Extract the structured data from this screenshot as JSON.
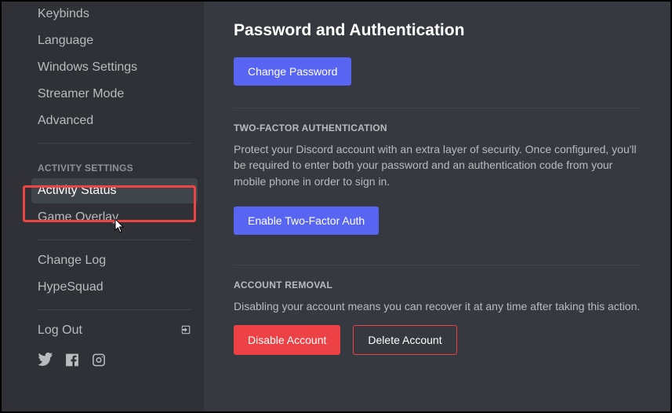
{
  "sidebar": {
    "items": [
      {
        "label": "Keybinds"
      },
      {
        "label": "Language"
      },
      {
        "label": "Windows Settings"
      },
      {
        "label": "Streamer Mode"
      },
      {
        "label": "Advanced"
      }
    ],
    "activity_header": "ACTIVITY SETTINGS",
    "activity_items": [
      {
        "label": "Activity Status"
      },
      {
        "label": "Game Overlay"
      }
    ],
    "misc_items": [
      {
        "label": "Change Log"
      },
      {
        "label": "HypeSquad"
      }
    ],
    "logout_label": "Log Out"
  },
  "main": {
    "title": "Password and Authentication",
    "change_password_label": "Change Password",
    "twofa_header": "TWO-FACTOR AUTHENTICATION",
    "twofa_desc": "Protect your Discord account with an extra layer of security. Once configured, you'll be required to enter both your password and an authentication code from your mobile phone in order to sign in.",
    "enable_twofa_label": "Enable Two-Factor Auth",
    "removal_header": "ACCOUNT REMOVAL",
    "removal_desc": "Disabling your account means you can recover it at any time after taking this action.",
    "disable_account_label": "Disable Account",
    "delete_account_label": "Delete Account"
  }
}
